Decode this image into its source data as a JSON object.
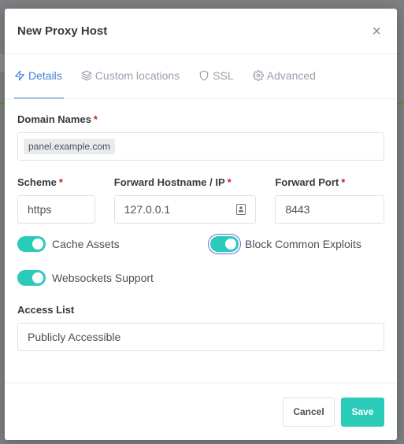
{
  "modal": {
    "title": "New Proxy Host",
    "close_glyph": "×"
  },
  "tabs": [
    {
      "label": "Details",
      "icon": "zap-icon",
      "active": true
    },
    {
      "label": "Custom locations",
      "icon": "layers-icon",
      "active": false
    },
    {
      "label": "SSL",
      "icon": "shield-icon",
      "active": false
    },
    {
      "label": "Advanced",
      "icon": "settings-icon",
      "active": false
    }
  ],
  "domain_names": {
    "label": "Domain Names",
    "required_marker": "*",
    "tags": [
      "panel.example.com"
    ]
  },
  "scheme": {
    "label": "Scheme",
    "required_marker": "*",
    "value": "https"
  },
  "forward_host": {
    "label": "Forward Hostname / IP",
    "required_marker": "*",
    "value": "127.0.0.1"
  },
  "forward_port": {
    "label": "Forward Port",
    "required_marker": "*",
    "value": "8443"
  },
  "toggles": {
    "cache_assets": {
      "label": "Cache Assets",
      "enabled": true
    },
    "block_exploits": {
      "label": "Block Common Exploits",
      "enabled": true
    },
    "websockets": {
      "label": "Websockets Support",
      "enabled": true
    }
  },
  "access_list": {
    "label": "Access List",
    "value": "Publicly Accessible"
  },
  "footer": {
    "cancel_label": "Cancel",
    "save_label": "Save"
  },
  "colors": {
    "accent": "#2bcbba",
    "active_tab": "#467fcf",
    "required": "#cd201f"
  }
}
